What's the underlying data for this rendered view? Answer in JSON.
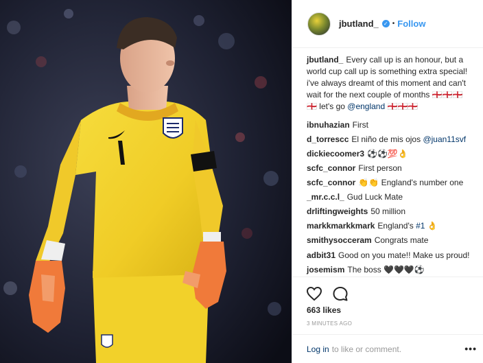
{
  "post": {
    "username": "jbutland_",
    "verified_icon": "verified-badge-icon",
    "dot": "•",
    "follow_label": "Follow",
    "caption": "Every call up is an honour, but a world cup call up is something extra special! i've always dreamt of this moment and can't wait for the next couple of months 🏴󠁧󠁢󠁥󠁮󠁧󠁿🏴󠁧󠁢󠁥󠁮󠁧󠁿🏴󠁧󠁢󠁥󠁮󠁧󠁿🏴󠁧󠁢󠁥󠁮󠁧󠁿 let's go",
    "caption_mention": "@england",
    "caption_tail": "🏴󠁧󠁢󠁥󠁮󠁧󠁿🏴󠁧󠁢󠁥󠁮󠁧󠁿🏴󠁧󠁢󠁥󠁮󠁧󠁿"
  },
  "comments": [
    {
      "user": "ibnuhazian",
      "text": "First",
      "mention": ""
    },
    {
      "user": "d_torrescc",
      "text": "El niño de mis ojos",
      "mention": "@juan11svf"
    },
    {
      "user": "dickiecoomer3",
      "text": "⚽⚽💯👌",
      "mention": ""
    },
    {
      "user": "scfc_connor",
      "text": "First person",
      "mention": ""
    },
    {
      "user": "scfc_connor",
      "text": "👏👏 England's number one",
      "mention": ""
    },
    {
      "user": "_mr.c.c.l_",
      "text": "Gud Luck Mate",
      "mention": ""
    },
    {
      "user": "drliftingweights",
      "text": "50 million",
      "mention": ""
    },
    {
      "user": "markkmarkkmark",
      "text": "England's",
      "mention": "#1 👌"
    },
    {
      "user": "smithysocceram",
      "text": "Congrats mate",
      "mention": ""
    },
    {
      "user": "adbit31",
      "text": "Good on you mate!! Make us proud!",
      "mention": ""
    },
    {
      "user": "josemism",
      "text": "The boss 🖤🖤🖤⚽",
      "mention": ""
    }
  ],
  "actions": {
    "like_icon": "heart-icon",
    "comment_icon": "speech-bubble-icon",
    "likes": "663 likes",
    "timestamp": "3 MINUTES AGO",
    "login_label": "Log in",
    "login_suffix": "to like or comment.",
    "more_label": "•••"
  },
  "colors": {
    "link_blue": "#3897f0",
    "mention_blue": "#003569",
    "jersey_yellow": "#f2d330",
    "glove_orange": "#f07a3a"
  }
}
